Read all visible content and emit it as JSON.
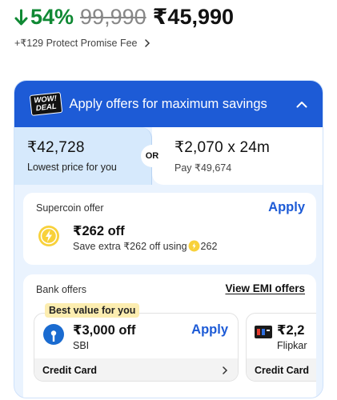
{
  "price": {
    "discount": "54%",
    "mrp": "99,990",
    "final": "₹45,990",
    "fee_text": "+₹129 Protect Promise Fee",
    "discount_color": "#108934"
  },
  "offers": {
    "badge_line1": "WOW!",
    "badge_line2": "DEAL",
    "title": "Apply offers for maximum savings",
    "accent_color": "#1d5bd6",
    "lowest": {
      "price": "₹42,728",
      "label": "Lowest price for you"
    },
    "or_label": "OR",
    "emi": {
      "price": "₹2,070 x 24m",
      "label": "Pay ₹49,674"
    },
    "supercoin": {
      "title": "Supercoin offer",
      "apply_label": "Apply",
      "amount": "₹262 off",
      "desc_prefix": "Save extra ₹262 off using",
      "desc_coins": "262"
    },
    "bank": {
      "title": "Bank offers",
      "emi_link": "View EMI offers",
      "best_value": "Best value for you",
      "tiles": [
        {
          "amount": "₹3,000 off",
          "bank": "SBI",
          "apply_label": "Apply",
          "card_type": "Credit Card",
          "icon": "sbi-logo"
        },
        {
          "amount": "₹2,2",
          "bank": "Flipkar",
          "card_type": "Credit Card",
          "icon": "flipkart-card-logo"
        }
      ]
    }
  }
}
